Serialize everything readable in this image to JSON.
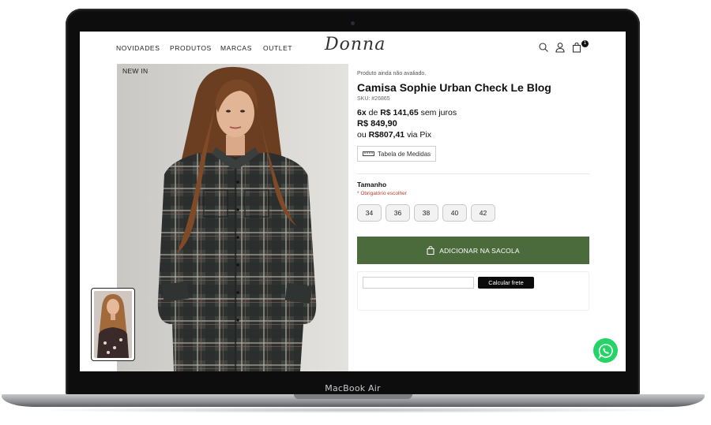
{
  "header": {
    "nav": [
      "NOVIDADES",
      "PRODUTOS",
      "MARCAS",
      "OUTLET"
    ],
    "logo": "Donna",
    "cart_count": "1"
  },
  "gallery": {
    "badge": "NEW IN"
  },
  "product": {
    "rating_text": "Produto ainda não avaliado.",
    "title": "Camisa Sophie Urban Check Le Blog",
    "sku": "SKU: #26865",
    "installment_count": "6x",
    "installment_word": " de ",
    "installment_value": "R$ 141,65",
    "installment_suffix": " sem juros",
    "price": "R$ 849,90",
    "pix_prefix": "ou ",
    "pix_value": "R$807,41",
    "pix_suffix": " via Pix",
    "size_table_label": "Tabela de Medidas",
    "size_label": "Tamanho",
    "size_required": "* Obrigatório escolher",
    "sizes": [
      "34",
      "36",
      "38",
      "40",
      "42"
    ],
    "add_to_bag": "ADICIONAR NA SACOLA",
    "freight_button": "Calcular frete"
  },
  "device": {
    "label": "MacBook Air"
  },
  "colors": {
    "accent": "#4b6b3d",
    "whatsapp": "#25d366"
  }
}
